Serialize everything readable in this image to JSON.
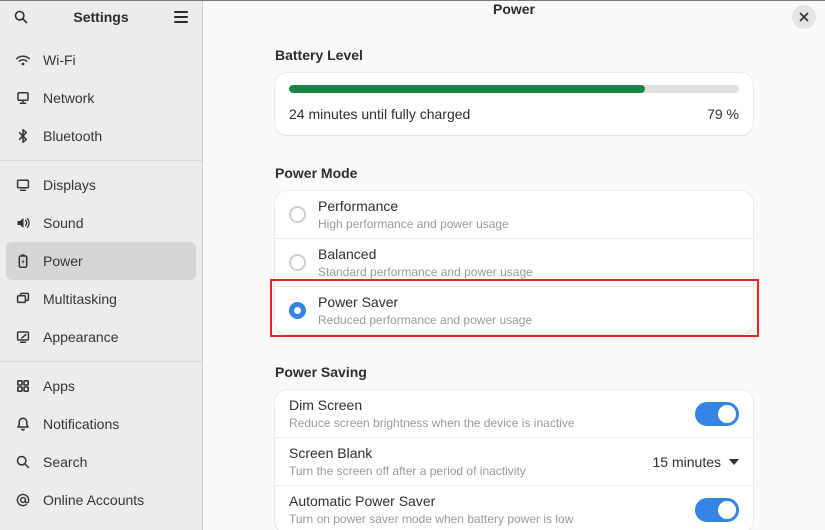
{
  "sidebar": {
    "title": "Settings",
    "groups": [
      {
        "items": [
          {
            "label": "Wi-Fi",
            "icon": "wifi"
          },
          {
            "label": "Network",
            "icon": "network"
          },
          {
            "label": "Bluetooth",
            "icon": "bluetooth"
          }
        ]
      },
      {
        "items": [
          {
            "label": "Displays",
            "icon": "displays"
          },
          {
            "label": "Sound",
            "icon": "sound"
          },
          {
            "label": "Power",
            "icon": "power",
            "selected": true
          },
          {
            "label": "Multitasking",
            "icon": "multitasking"
          },
          {
            "label": "Appearance",
            "icon": "appearance"
          }
        ]
      },
      {
        "items": [
          {
            "label": "Apps",
            "icon": "apps"
          },
          {
            "label": "Notifications",
            "icon": "notifications"
          },
          {
            "label": "Search",
            "icon": "search"
          },
          {
            "label": "Online Accounts",
            "icon": "online-accounts"
          }
        ]
      }
    ]
  },
  "header": {
    "title": "Power"
  },
  "battery": {
    "section_title": "Battery Level",
    "status_text": "24 minutes until fully charged",
    "percent_text": "79 %",
    "percent": 79
  },
  "power_mode": {
    "section_title": "Power Mode",
    "options": [
      {
        "title": "Performance",
        "subtitle": "High performance and power usage",
        "selected": false
      },
      {
        "title": "Balanced",
        "subtitle": "Standard performance and power usage",
        "selected": false
      },
      {
        "title": "Power Saver",
        "subtitle": "Reduced performance and power usage",
        "selected": true,
        "annotated": true
      }
    ]
  },
  "power_saving": {
    "section_title": "Power Saving",
    "rows": [
      {
        "title": "Dim Screen",
        "subtitle": "Reduce screen brightness when the device is inactive",
        "control": "toggle",
        "on": true
      },
      {
        "title": "Screen Blank",
        "subtitle": "Turn the screen off after a period of inactivity",
        "control": "dropdown",
        "value": "15 minutes"
      },
      {
        "title": "Automatic Power Saver",
        "subtitle": "Turn on power saver mode when battery power is low",
        "control": "toggle",
        "on": true
      }
    ]
  },
  "colors": {
    "accent_blue": "#3584e4",
    "battery_green": "#178644",
    "annotation_red": "#ee2222",
    "sidebar_bg": "#ececeb",
    "selected_item_bg": "#d6d6d4"
  }
}
